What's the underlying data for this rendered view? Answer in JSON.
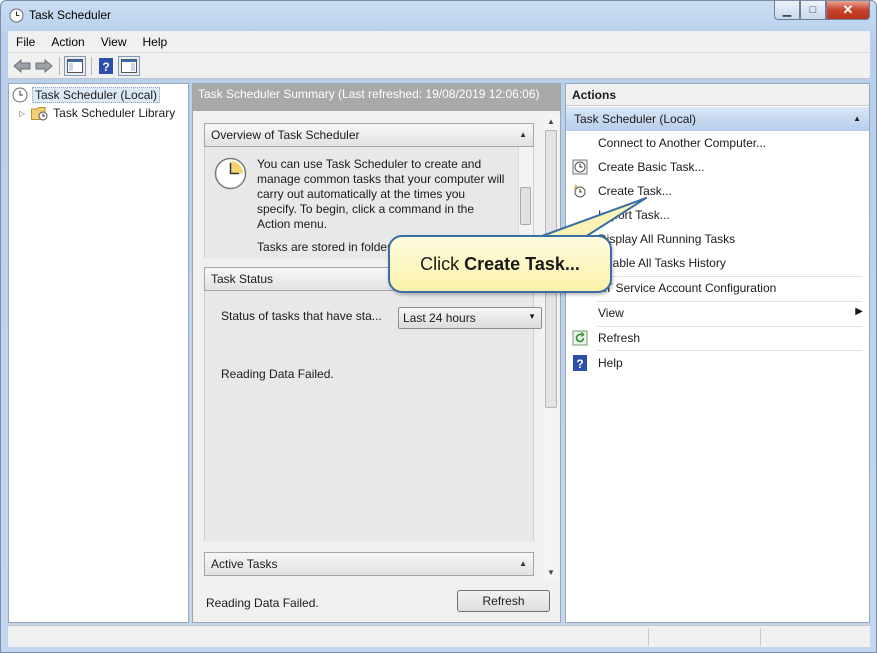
{
  "window": {
    "title": "Task Scheduler",
    "caption": {
      "minimize": "▁",
      "maximize": "□",
      "close": "✕"
    }
  },
  "menu": [
    "File",
    "Action",
    "View",
    "Help"
  ],
  "toolbar": {
    "icons": [
      "back-arrow-icon",
      "forward-arrow-icon",
      "show-hide-console-tree-icon",
      "help-icon",
      "show-hide-action-pane-icon"
    ]
  },
  "tree": {
    "root": "Task Scheduler (Local)",
    "library": "Task Scheduler Library"
  },
  "summary": {
    "heading": "Task Scheduler Summary (Last refreshed: 19/08/2019 12:06:06)",
    "overview": {
      "title": "Overview of Task Scheduler",
      "text": "You can use Task Scheduler to create and manage common tasks that your computer will carry out automatically at the times you specify. To begin, click a command in the Action menu.",
      "text2": "Tasks are stored in folder"
    },
    "task_status": {
      "title": "Task Status",
      "label": "Status of tasks that have sta...",
      "select_value": "Last 24 hours",
      "message": "Reading Data Failed."
    },
    "active_tasks": {
      "title": "Active Tasks"
    },
    "footer_message": "Reading Data Failed.",
    "refresh_label": "Refresh"
  },
  "actions": {
    "heading": "Actions",
    "group": "Task Scheduler (Local)",
    "items": [
      {
        "label": "Connect to Another Computer...",
        "icon": "none"
      },
      {
        "label": "Create Basic Task...",
        "icon": "basic-task-icon"
      },
      {
        "label": "Create Task...",
        "icon": "create-task-icon"
      },
      {
        "label": "Import Task...",
        "icon": "none"
      },
      {
        "label": "Display All Running Tasks",
        "icon": "running-tasks-icon"
      },
      {
        "label": "Enable All Tasks History",
        "icon": "history-icon"
      },
      {
        "label": "AT Service Account Configuration",
        "icon": "none"
      },
      {
        "label": "View",
        "icon": "none"
      },
      {
        "label": "Refresh",
        "icon": "refresh-icon"
      },
      {
        "label": "Help",
        "icon": "help-icon"
      }
    ]
  },
  "callout": {
    "prefix": "Click ",
    "bold": "Create Task..."
  },
  "colors": {
    "accent": "#3a6ea5",
    "callout_fill": "#fbf1a9",
    "summary_header": "#a9a9a9",
    "actions_group": "#c6d9f1"
  }
}
